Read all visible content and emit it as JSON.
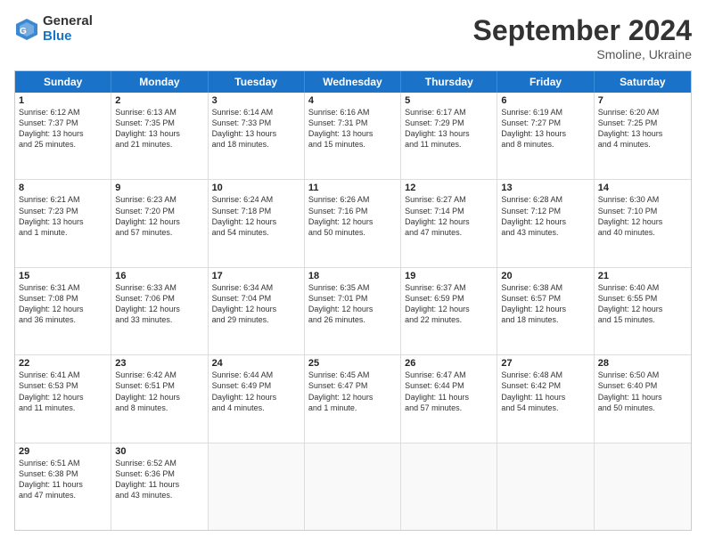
{
  "logo": {
    "line1": "General",
    "line2": "Blue"
  },
  "title": "September 2024",
  "subtitle": "Smoline, Ukraine",
  "days": [
    "Sunday",
    "Monday",
    "Tuesday",
    "Wednesday",
    "Thursday",
    "Friday",
    "Saturday"
  ],
  "weeks": [
    [
      {
        "day": "1",
        "text": "Sunrise: 6:12 AM\nSunset: 7:37 PM\nDaylight: 13 hours\nand 25 minutes."
      },
      {
        "day": "2",
        "text": "Sunrise: 6:13 AM\nSunset: 7:35 PM\nDaylight: 13 hours\nand 21 minutes."
      },
      {
        "day": "3",
        "text": "Sunrise: 6:14 AM\nSunset: 7:33 PM\nDaylight: 13 hours\nand 18 minutes."
      },
      {
        "day": "4",
        "text": "Sunrise: 6:16 AM\nSunset: 7:31 PM\nDaylight: 13 hours\nand 15 minutes."
      },
      {
        "day": "5",
        "text": "Sunrise: 6:17 AM\nSunset: 7:29 PM\nDaylight: 13 hours\nand 11 minutes."
      },
      {
        "day": "6",
        "text": "Sunrise: 6:19 AM\nSunset: 7:27 PM\nDaylight: 13 hours\nand 8 minutes."
      },
      {
        "day": "7",
        "text": "Sunrise: 6:20 AM\nSunset: 7:25 PM\nDaylight: 13 hours\nand 4 minutes."
      }
    ],
    [
      {
        "day": "8",
        "text": "Sunrise: 6:21 AM\nSunset: 7:23 PM\nDaylight: 13 hours\nand 1 minute."
      },
      {
        "day": "9",
        "text": "Sunrise: 6:23 AM\nSunset: 7:20 PM\nDaylight: 12 hours\nand 57 minutes."
      },
      {
        "day": "10",
        "text": "Sunrise: 6:24 AM\nSunset: 7:18 PM\nDaylight: 12 hours\nand 54 minutes."
      },
      {
        "day": "11",
        "text": "Sunrise: 6:26 AM\nSunset: 7:16 PM\nDaylight: 12 hours\nand 50 minutes."
      },
      {
        "day": "12",
        "text": "Sunrise: 6:27 AM\nSunset: 7:14 PM\nDaylight: 12 hours\nand 47 minutes."
      },
      {
        "day": "13",
        "text": "Sunrise: 6:28 AM\nSunset: 7:12 PM\nDaylight: 12 hours\nand 43 minutes."
      },
      {
        "day": "14",
        "text": "Sunrise: 6:30 AM\nSunset: 7:10 PM\nDaylight: 12 hours\nand 40 minutes."
      }
    ],
    [
      {
        "day": "15",
        "text": "Sunrise: 6:31 AM\nSunset: 7:08 PM\nDaylight: 12 hours\nand 36 minutes."
      },
      {
        "day": "16",
        "text": "Sunrise: 6:33 AM\nSunset: 7:06 PM\nDaylight: 12 hours\nand 33 minutes."
      },
      {
        "day": "17",
        "text": "Sunrise: 6:34 AM\nSunset: 7:04 PM\nDaylight: 12 hours\nand 29 minutes."
      },
      {
        "day": "18",
        "text": "Sunrise: 6:35 AM\nSunset: 7:01 PM\nDaylight: 12 hours\nand 26 minutes."
      },
      {
        "day": "19",
        "text": "Sunrise: 6:37 AM\nSunset: 6:59 PM\nDaylight: 12 hours\nand 22 minutes."
      },
      {
        "day": "20",
        "text": "Sunrise: 6:38 AM\nSunset: 6:57 PM\nDaylight: 12 hours\nand 18 minutes."
      },
      {
        "day": "21",
        "text": "Sunrise: 6:40 AM\nSunset: 6:55 PM\nDaylight: 12 hours\nand 15 minutes."
      }
    ],
    [
      {
        "day": "22",
        "text": "Sunrise: 6:41 AM\nSunset: 6:53 PM\nDaylight: 12 hours\nand 11 minutes."
      },
      {
        "day": "23",
        "text": "Sunrise: 6:42 AM\nSunset: 6:51 PM\nDaylight: 12 hours\nand 8 minutes."
      },
      {
        "day": "24",
        "text": "Sunrise: 6:44 AM\nSunset: 6:49 PM\nDaylight: 12 hours\nand 4 minutes."
      },
      {
        "day": "25",
        "text": "Sunrise: 6:45 AM\nSunset: 6:47 PM\nDaylight: 12 hours\nand 1 minute."
      },
      {
        "day": "26",
        "text": "Sunrise: 6:47 AM\nSunset: 6:44 PM\nDaylight: 11 hours\nand 57 minutes."
      },
      {
        "day": "27",
        "text": "Sunrise: 6:48 AM\nSunset: 6:42 PM\nDaylight: 11 hours\nand 54 minutes."
      },
      {
        "day": "28",
        "text": "Sunrise: 6:50 AM\nSunset: 6:40 PM\nDaylight: 11 hours\nand 50 minutes."
      }
    ],
    [
      {
        "day": "29",
        "text": "Sunrise: 6:51 AM\nSunset: 6:38 PM\nDaylight: 11 hours\nand 47 minutes."
      },
      {
        "day": "30",
        "text": "Sunrise: 6:52 AM\nSunset: 6:36 PM\nDaylight: 11 hours\nand 43 minutes."
      },
      {
        "day": "",
        "text": ""
      },
      {
        "day": "",
        "text": ""
      },
      {
        "day": "",
        "text": ""
      },
      {
        "day": "",
        "text": ""
      },
      {
        "day": "",
        "text": ""
      }
    ]
  ]
}
